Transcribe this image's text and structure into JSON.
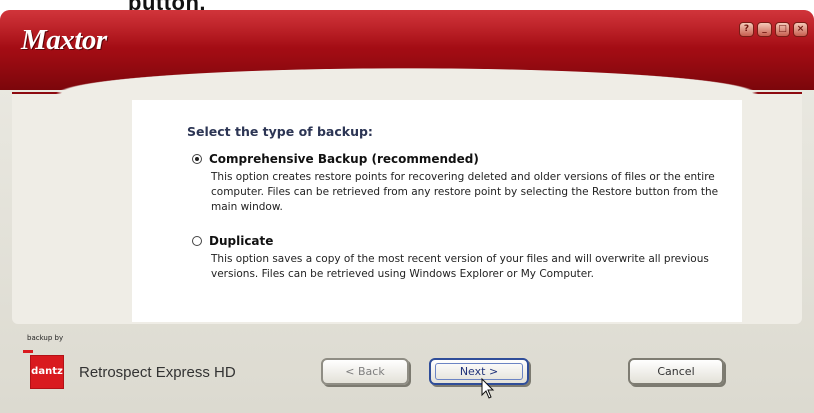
{
  "caption": "button.",
  "window": {
    "brand": "Maxtor",
    "controls": [
      "?",
      "_",
      "□",
      "×"
    ]
  },
  "panel": {
    "heading": "Select the type of backup:",
    "options": [
      {
        "label": "Comprehensive Backup (recommended)",
        "selected": true,
        "description": "This option creates restore points for recovering deleted and older versions of files or the entire computer. Files can be retrieved from any restore point by selecting the Restore button from the main window."
      },
      {
        "label": "Duplicate",
        "selected": false,
        "description": "This option saves a copy of the most recent version of your files and will overwrite all previous versions. Files can be retrieved using Windows Explorer or My Computer."
      }
    ]
  },
  "footer": {
    "backup_by": "backup by",
    "vendor_logo": "dantz",
    "product": "Retrospect Express HD",
    "back_label": "< Back",
    "next_label": "Next >",
    "cancel_label": "Cancel"
  },
  "colors": {
    "titlebar": "#a00c13",
    "heading": "#2c3554",
    "next_border": "#2f4d99"
  }
}
